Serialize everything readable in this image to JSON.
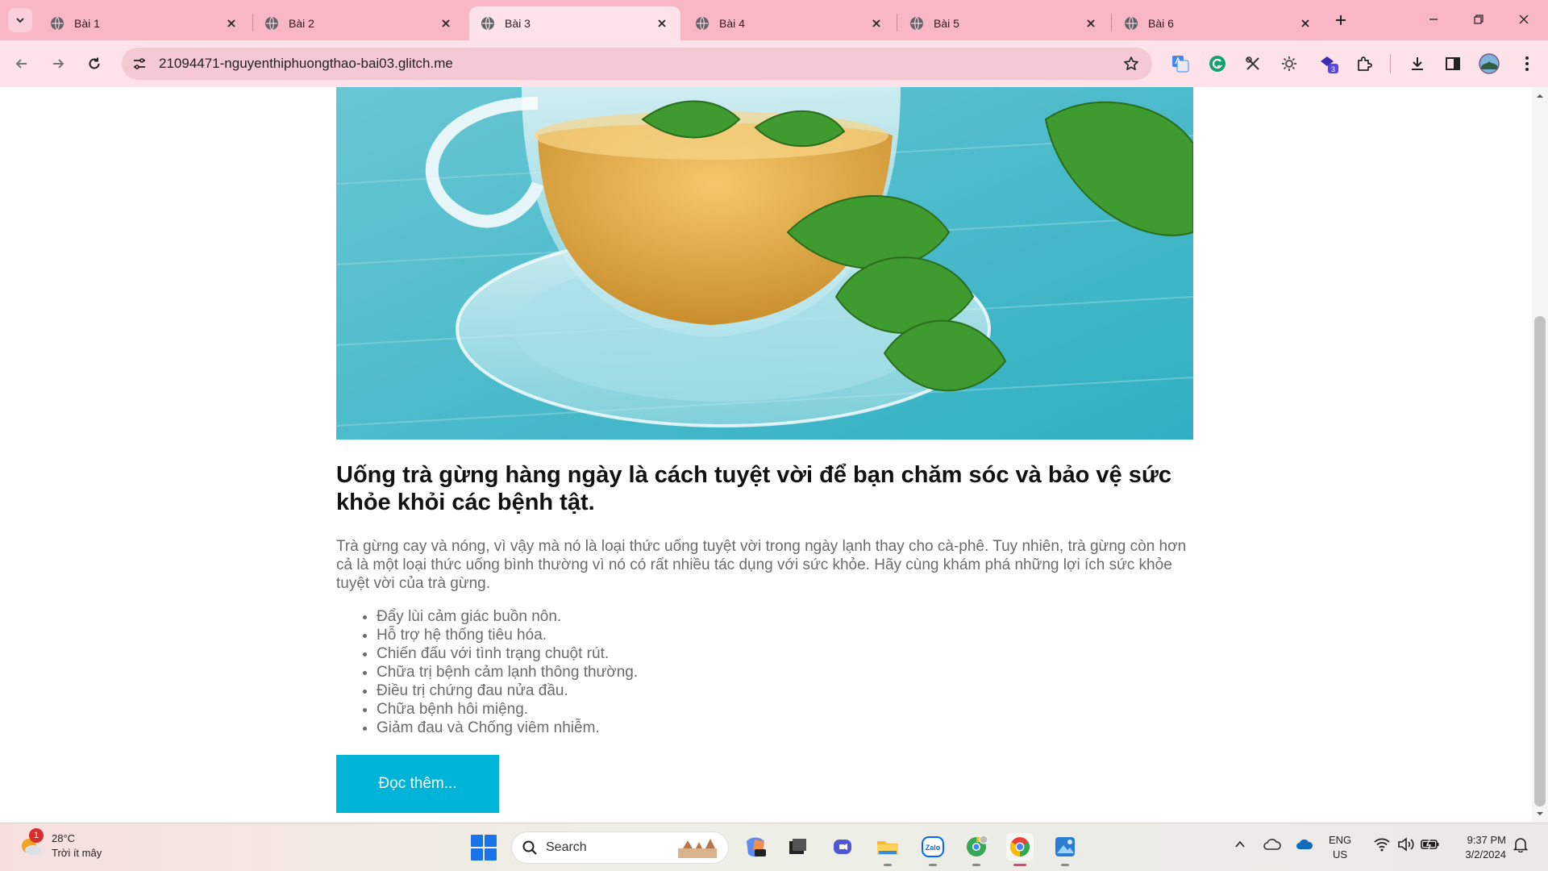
{
  "browser": {
    "tabs": [
      {
        "label": "Bài 1",
        "active": false
      },
      {
        "label": "Bài 2",
        "active": false
      },
      {
        "label": "Bài 3",
        "active": true
      },
      {
        "label": "Bài 4",
        "active": false
      },
      {
        "label": "Bài 5",
        "active": false
      },
      {
        "label": "Bài 6",
        "active": false
      }
    ],
    "url": "21094471-nguyenthiphuongthao-bai03.glitch.me",
    "extension_badge": "3"
  },
  "article": {
    "heading": "Uống trà gừng hàng ngày là cách tuyệt vời để bạn chăm sóc và bảo vệ sức khỏe khỏi các bệnh tật.",
    "intro": "Trà gừng cay và nóng, vì vậy mà nó là loại thức uống tuyệt vời trong ngày lạnh thay cho cà-phê. Tuy nhiên, trà gừng còn hơn cả là một loại thức uống bình thường vì nó có rất nhiều tác dụng với sức khỏe. Hãy cùng khám phá những lợi ích sức khỏe tuyệt vời của trà gừng.",
    "benefits": [
      "Đẩy lùi cảm giác buồn nôn.",
      "Hỗ trợ hệ thống tiêu hóa.",
      "Chiến đấu với tình trạng chuột rút.",
      "Chữa trị bệnh cảm lạnh thông thường.",
      "Điều trị chứng đau nửa đầu.",
      "Chữa bệnh hôi miệng.",
      "Giảm đau và Chống viêm nhiễm."
    ],
    "read_more_label": "Đọc thêm..."
  },
  "taskbar": {
    "weather_temp": "28°C",
    "weather_desc": "Trời ít mây",
    "weather_badge": "1",
    "search_label": "Search",
    "lang_line1": "ENG",
    "lang_line2": "US",
    "time": "9:37 PM",
    "date": "3/2/2024"
  },
  "colors": {
    "accent_button": "#00b4d8",
    "tabbar": "#f9b6c5",
    "toolbar": "#fde3e9"
  }
}
